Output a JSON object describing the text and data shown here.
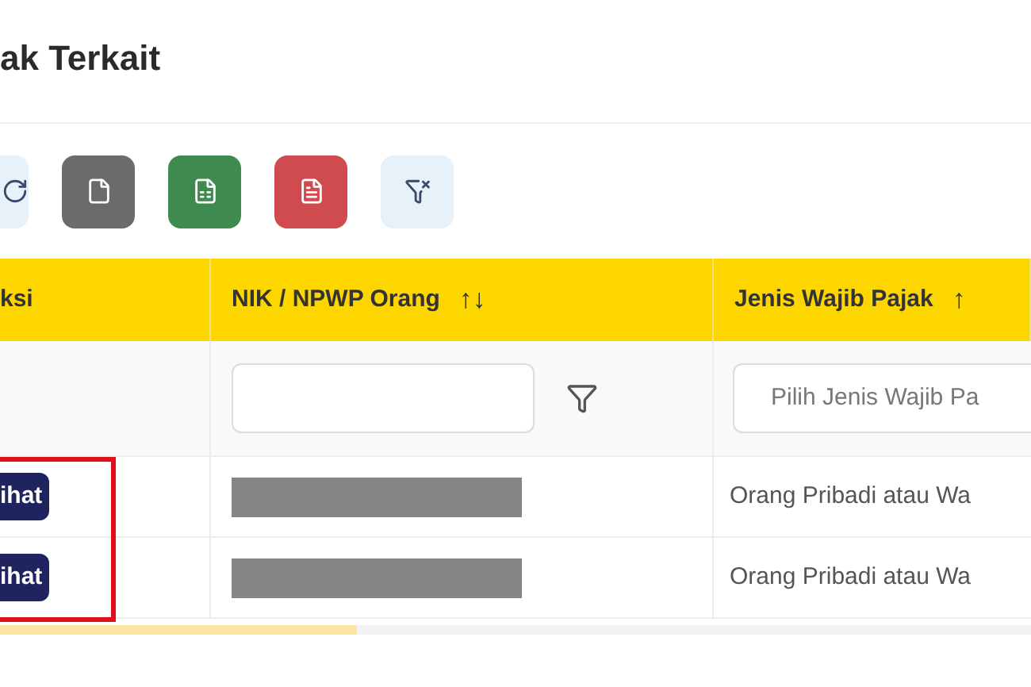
{
  "title": "ak Terkait",
  "toolbar": [
    {
      "kind": "refresh"
    },
    {
      "kind": "copy"
    },
    {
      "kind": "excel"
    },
    {
      "kind": "pdf"
    },
    {
      "kind": "clear-filter"
    }
  ],
  "table": {
    "columns": [
      {
        "label": "ksi"
      },
      {
        "label": "NIK / NPWP Orang",
        "sort_icon": "↑↓"
      },
      {
        "label": "Jenis Wajib Pajak",
        "sort_icon": "↑"
      }
    ],
    "filters": {
      "jenis_select": {
        "placeholder": "Pilih Jenis Wajib Pa"
      }
    },
    "rows": [
      {
        "action": "ihat",
        "jenis": "Orang Pribadi atau Wa",
        "highlighted": true
      },
      {
        "action": "ihat",
        "jenis": "Orang Pribadi atau Wa",
        "highlighted": true
      }
    ]
  }
}
